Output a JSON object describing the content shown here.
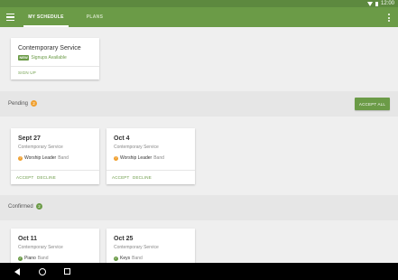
{
  "status_bar": {
    "time": "12:00"
  },
  "app_bar": {
    "tabs": [
      {
        "label": "MY SCHEDULE",
        "active": true
      },
      {
        "label": "PLANS",
        "active": false
      }
    ]
  },
  "signup_card": {
    "title": "Contemporary Service",
    "new_badge": "NEW",
    "subtitle": "Signups Available",
    "action": "SIGN UP"
  },
  "pending": {
    "label": "Pending",
    "count": "2",
    "accept_all": "ACCEPT ALL",
    "cards": [
      {
        "date": "Sept 27",
        "service": "Contemporary Service",
        "role": "Worship Leader",
        "team": "Band",
        "accept": "ACCEPT",
        "decline": "DECLINE"
      },
      {
        "date": "Oct 4",
        "service": "Contemporary Service",
        "role": "Worship Leader",
        "team": "Band",
        "accept": "ACCEPT",
        "decline": "DECLINE"
      }
    ]
  },
  "confirmed": {
    "label": "Confirmed",
    "count": "2",
    "cards": [
      {
        "date": "Oct 11",
        "service": "Contemporary Service",
        "role": "Piano",
        "team": "Band"
      },
      {
        "date": "Oct 25",
        "service": "Contemporary Service",
        "role": "Keys",
        "team": "Band"
      }
    ]
  },
  "colors": {
    "brand_green": "#6b9b47",
    "pending_orange": "#f0a030",
    "confirmed_green": "#6b9b47"
  },
  "icons": {
    "pending_role": "question-circle-icon",
    "confirmed_role": "check-circle-icon"
  }
}
